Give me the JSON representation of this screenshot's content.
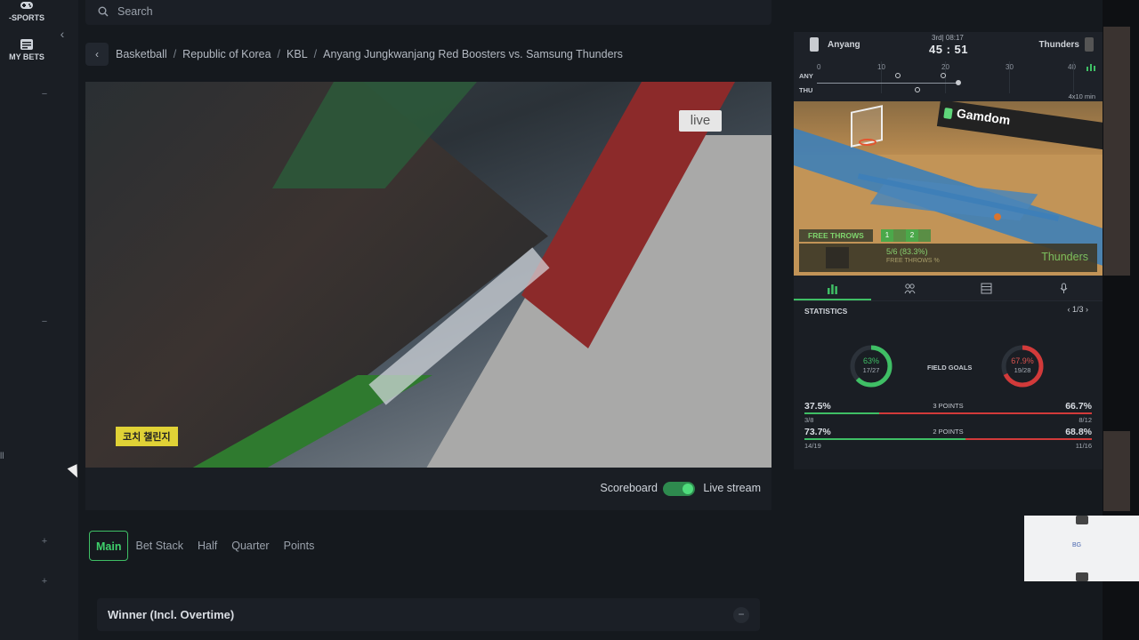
{
  "sidebar": {
    "items": [
      {
        "label": "-SPORTS",
        "icon": "gamepad-icon"
      },
      {
        "label": "MY BETS",
        "icon": "bets-icon"
      }
    ],
    "edge_text": "ll"
  },
  "search": {
    "placeholder": "Search"
  },
  "breadcrumb": [
    "Basketball",
    "Republic of Korea",
    "KBL",
    "Anyang Jungkwanjang Red Boosters vs. Samsung Thunders"
  ],
  "video": {
    "live_badge": "live",
    "overlay_tag": "코치 챌린지"
  },
  "video_bar": {
    "scoreboard_label": "Scoreboard",
    "livestream_label": "Live stream",
    "toggle_on": true
  },
  "tabs": [
    "Main",
    "Bet Stack",
    "Half",
    "Quarter",
    "Points"
  ],
  "active_tab": "Main",
  "market": {
    "title": "Winner (Incl. Overtime)",
    "toggle": "−"
  },
  "scoreboard": {
    "team_a": "Anyang",
    "team_b": "Thunders",
    "period": "3rd| 08:17",
    "score": "45 : 51",
    "row_a": "ANY",
    "row_b": "THU",
    "ticks": [
      "0",
      "10",
      "20",
      "30",
      "40"
    ],
    "format": "4x10 min"
  },
  "court": {
    "sponsor": "Gamdom",
    "free_throws_label": "FREE THROWS",
    "ft_boxes": [
      "1",
      "",
      "2",
      ""
    ],
    "ft_value": "5/6 (83.3%)",
    "ft_sub": "FREE THROWS %",
    "team": "Thunders"
  },
  "stats": {
    "title": "STATISTICS",
    "pager": "1/3",
    "field_goals_label": "FIELD GOALS",
    "donut_left": {
      "pct": "63%",
      "sub": "17/27",
      "value": 0.63,
      "color": "#3fbf65"
    },
    "donut_right": {
      "pct": "67.9%",
      "sub": "19/28",
      "value": 0.679,
      "color": "#d23a3a"
    },
    "rows": [
      {
        "left_pct": "37.5%",
        "label": "3 POINTS",
        "right_pct": "66.7%",
        "left_sub": "3/8",
        "right_sub": "8/12",
        "left_share": 0.26
      },
      {
        "left_pct": "73.7%",
        "label": "2 POINTS",
        "right_pct": "68.8%",
        "left_sub": "14/19",
        "right_sub": "11/16",
        "left_share": 0.56
      }
    ]
  },
  "popup": {
    "text": "BG"
  }
}
